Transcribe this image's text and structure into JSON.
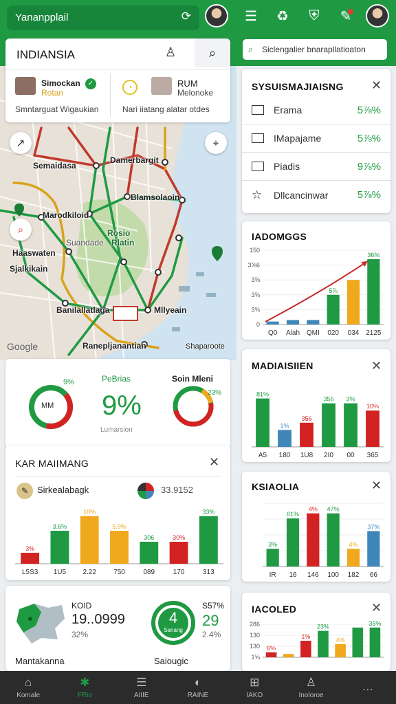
{
  "topbar": {
    "search_text": "Yananpplail"
  },
  "map_panel": {
    "title": "INDIANSIA",
    "station_a": {
      "name": "Simockan",
      "sub": "Rotan",
      "desc": "Smntarguat Wigaukian"
    },
    "station_b": {
      "name": "RUM",
      "sub": "Melonoke",
      "desc": "Nari iiatang alatar otdes"
    },
    "labels": [
      "Semaidasa",
      "Damerbargit",
      "Marodkiloid",
      "Blamsolaoin",
      "Haaswaten",
      "Sjalkikain",
      "Suandade",
      "Rosio",
      "Rlatin",
      "Banilallatlaga",
      "Mllyeain",
      "Ranepljanantian",
      "Shaparoote"
    ],
    "google": "Google"
  },
  "right_search": {
    "text": "Siclengalier bnarapllatioaton"
  },
  "stat_card_1": {
    "title": "SYSUISMAJIAISNG",
    "rows": [
      {
        "label": "Erama",
        "value": "5⅞%"
      },
      {
        "label": "IMapajame",
        "value": "5⅞%"
      },
      {
        "label": "Piadis",
        "value": "9⅞%"
      },
      {
        "label": "Dllcancinwar",
        "value": "5⅞%"
      }
    ]
  },
  "donut_card": {
    "donut1_center": "MM",
    "donut1_pct": "9%",
    "legend_title": "PeBrias",
    "big_value": "9%",
    "caption": "Lumarsion",
    "donut2_title": "Soin Mleni",
    "donut2_pct": "23%"
  },
  "bar_card_left": {
    "title": "KAR MAIIMANG",
    "legend1": "Sirkealabagk",
    "legend2": "33.9152",
    "colors": {
      "green": "#1f9a43",
      "red": "#d32222",
      "amber": "#f0a91c"
    }
  },
  "bottom_left_card": {
    "label": "KOID",
    "value": "19..0999",
    "pct": "32%",
    "caption": "Mantakanna",
    "gauge_num": "4",
    "gauge_sub": "Sanang",
    "side_pct": "S57%",
    "side_value": "29",
    "side_sub": "2.4%",
    "gauge_caption": "Saiougic"
  },
  "chart_card_a": {
    "title": "IADOMGGS"
  },
  "chart_card_b": {
    "title": "MADIAISIIEN"
  },
  "chart_card_c": {
    "title": "KSIAOLIA"
  },
  "chart_card_d": {
    "title": "IACOLED"
  },
  "chart_data": [
    {
      "type": "bar",
      "title": "KAR MAIIMANG",
      "categories": [
        "L5S3",
        "1U5",
        "2.22",
        "750",
        "089",
        "170",
        "313"
      ],
      "values": [
        3,
        9,
        13,
        9,
        6,
        6,
        13
      ],
      "labels": [
        "3%",
        "3.6%",
        "10%",
        "5.9%",
        "306",
        "30%",
        "33%"
      ],
      "colors": [
        "#d32222",
        "#1f9a43",
        "#f0a91c",
        "#f0a91c",
        "#1f9a43",
        "#d32222",
        "#1f9a43"
      ],
      "ylim": [
        0,
        15
      ]
    },
    {
      "type": "bar",
      "title": "IADOMGGS",
      "categories": [
        "Q0",
        "Alah",
        "QMI",
        "020",
        "034",
        "2125"
      ],
      "values": [
        1,
        1.5,
        1.5,
        10,
        15,
        22
      ],
      "labels": [
        "",
        "",
        "",
        "5⅞",
        "",
        "36%"
      ],
      "colors": [
        "#3f87b8",
        "#3f87b8",
        "#3f87b8",
        "#1f9a43",
        "#f0a91c",
        "#1f9a43"
      ],
      "yticks": [
        "150",
        "3⅝6",
        "3⅝",
        "3⅝",
        "3⅝",
        "0"
      ],
      "ylim": [
        0,
        25
      ]
    },
    {
      "type": "bar",
      "title": "MADIAISIIEN",
      "categories": [
        "A5",
        "180",
        "1U8",
        "2I0",
        "00",
        "365"
      ],
      "values": [
        20,
        7,
        10,
        18,
        18,
        15
      ],
      "labels": [
        "81%",
        "1%",
        "356",
        "356",
        "3%",
        "10%"
      ],
      "colors": [
        "#1f9a43",
        "#3f87b8",
        "#d32222",
        "#1f9a43",
        "#1f9a43",
        "#d32222"
      ],
      "ylim": [
        0,
        25
      ]
    },
    {
      "type": "bar",
      "title": "KSIAOLIA",
      "categories": [
        "IR",
        "16",
        "146",
        "100",
        "182",
        "66"
      ],
      "values": [
        7,
        19,
        21,
        21,
        7,
        14
      ],
      "labels": [
        "3%",
        "61%",
        "4%",
        "47%",
        "4%",
        "37%"
      ],
      "colors": [
        "#1f9a43",
        "#1f9a43",
        "#d32222",
        "#1f9a43",
        "#f0a91c",
        "#3f87b8"
      ],
      "yticks": [
        "",
        "",
        "",
        "",
        ""
      ],
      "ylim": [
        0,
        25
      ]
    },
    {
      "type": "bar",
      "title": "IACOLED",
      "categories": [
        "",
        "",
        "",
        "",
        "",
        "",
        ""
      ],
      "values": [
        3,
        2,
        10,
        16,
        8,
        18,
        18
      ],
      "labels": [
        "6%",
        "",
        "1%",
        "23%",
        "4%",
        "",
        "35%"
      ],
      "colors": [
        "#d32222",
        "#f0a91c",
        "#d32222",
        "#1f9a43",
        "#f0a91c",
        "#1f9a43",
        "#1f9a43"
      ],
      "yticks": [
        "286",
        "130",
        "130",
        "1⅝"
      ],
      "ylim": [
        0,
        20
      ]
    }
  ],
  "bottom_nav": [
    {
      "icon": "⌂",
      "label": "Komale"
    },
    {
      "icon": "✱",
      "label": "FRio"
    },
    {
      "icon": "☰",
      "label": "AIIIE"
    },
    {
      "icon": "◐",
      "label": "RAINE"
    },
    {
      "icon": "⊞",
      "label": "IAKO"
    },
    {
      "icon": "♙",
      "label": "Inoloroe"
    },
    {
      "icon": "…",
      "label": ""
    }
  ]
}
